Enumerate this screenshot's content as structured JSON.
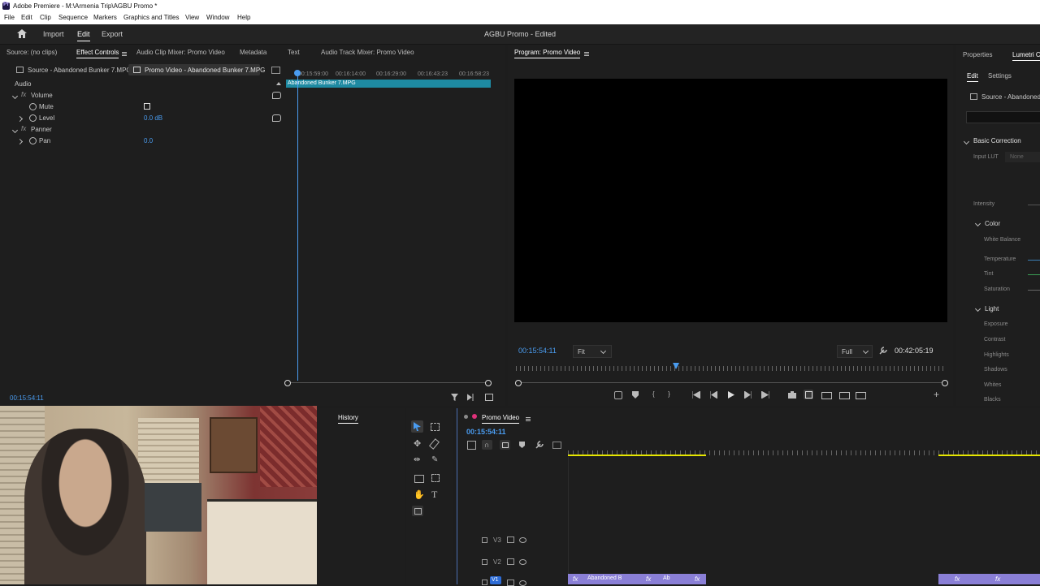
{
  "os": {
    "window_title": "Adobe Premiere - M:\\Armenia Trip\\AGBU Promo *",
    "logo_text": "Pr",
    "menu": [
      "File",
      "Edit",
      "Clip",
      "Sequence",
      "Markers",
      "Graphics and Titles",
      "View",
      "Window",
      "Help"
    ]
  },
  "app": {
    "nav": [
      "Import",
      "Edit",
      "Export"
    ],
    "active_nav": "Edit",
    "project_title": "AGBU Promo - Edited"
  },
  "source_panel": {
    "tabs": [
      "Source: (no clips)",
      "Effect Controls",
      "Audio Clip Mixer: Promo Video",
      "Metadata",
      "Text",
      "Audio Track Mixer: Promo Video"
    ],
    "active_tab": "Effect Controls",
    "clip_source": "Source - Abandoned Bunker 7.MPG",
    "clip_sequence": "Promo Video - Abandoned Bunker 7.MPG",
    "section_label": "Audio",
    "effects": {
      "volume": "Volume",
      "mute": "Mute",
      "level": "Level",
      "level_value": "0.0 dB",
      "panner": "Panner",
      "pan": "Pan",
      "pan_value": "0.0"
    },
    "ruler": [
      "00:15:59:00",
      "00:16:14:00",
      "00:16:29:00",
      "00:16:43:23",
      "00:16:58:23"
    ],
    "clip_bar": "Abandoned Bunker 7.MPG",
    "timecode": "00:15:54:11"
  },
  "program_monitor": {
    "title": "Program: Promo Video",
    "timecode": "00:15:54:11",
    "fit": "Fit",
    "quality": "Full",
    "duration": "00:42:05:19"
  },
  "lumetri": {
    "tabs": [
      "Properties",
      "Lumetri Co"
    ],
    "subtabs": [
      "Edit",
      "Settings"
    ],
    "source": "Source - Abandoned B",
    "basic_correction": "Basic Correction",
    "input_lut": "Input LUT",
    "input_lut_value": "None",
    "intensity": "Intensity",
    "color": "Color",
    "white_balance": "White Balance",
    "temperature": "Temperature",
    "tint": "Tint",
    "saturation": "Saturation",
    "light": "Light",
    "exposure": "Exposure",
    "contrast": "Contrast",
    "highlights": "Highlights",
    "shadows": "Shadows",
    "whites": "Whites",
    "blacks": "Blacks"
  },
  "history": {
    "title": "History"
  },
  "timeline": {
    "title": "Promo Video",
    "timecode": "00:15:54:11",
    "tracks": [
      "V3",
      "V2",
      "V1"
    ],
    "clips": [
      "Abandoned B",
      "Ab"
    ]
  },
  "colors": {
    "accent": "#4a9cf0",
    "clip_teal": "#1e8aa2",
    "clip_purple": "#8a7fd6",
    "render_yellow": "#e6e600"
  }
}
